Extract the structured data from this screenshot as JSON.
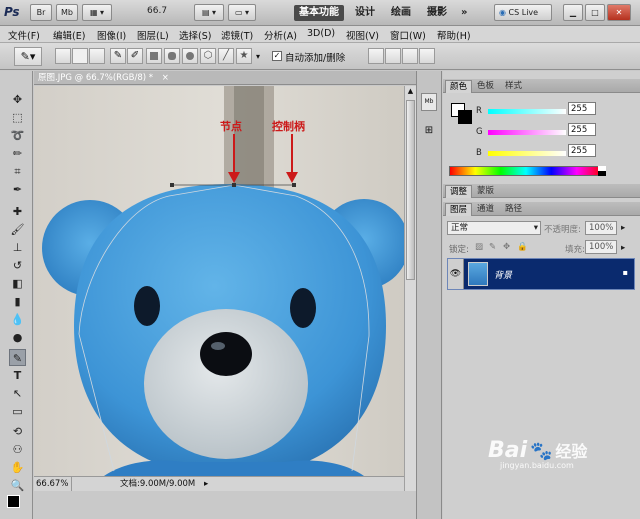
{
  "app": {
    "logo": "Ps",
    "br_label": "Br",
    "mb_label": "Mb",
    "zoom_value": "66.7",
    "workspaces": [
      "基本功能",
      "设计",
      "绘画",
      "摄影"
    ],
    "cs_live_label": "CS Live",
    "overflow_symbol": "»"
  },
  "menus": [
    "文件(F)",
    "编辑(E)",
    "图像(I)",
    "图层(L)",
    "选择(S)",
    "滤镜(T)",
    "分析(A)",
    "3D(D)",
    "视图(V)",
    "窗口(W)",
    "帮助(H)"
  ],
  "options": {
    "auto_add_delete_label": "自动添加/删除",
    "auto_add_delete_checked": true
  },
  "document": {
    "tab_title": "原图.JPG @ 66.7%(RGB/8) *",
    "zoom_status": "66.67%",
    "doc_info": "文档:9.00M/9.00M"
  },
  "annotations": {
    "anchor_label": "节点",
    "handle_label": "控制柄",
    "color": "#cc1a1a"
  },
  "color_panel": {
    "tabs": [
      "颜色",
      "色板",
      "样式"
    ],
    "channels": [
      {
        "label": "R",
        "value": "255"
      },
      {
        "label": "G",
        "value": "255"
      },
      {
        "label": "B",
        "value": "255"
      }
    ]
  },
  "adjust_panel": {
    "tabs": [
      "调整",
      "蒙版"
    ]
  },
  "layers_panel": {
    "tabs": [
      "图层",
      "通道",
      "路径"
    ],
    "blend_mode": "正常",
    "opacity_label": "不透明度:",
    "opacity_value": "100%",
    "lock_label": "锁定:",
    "fill_label": "填充:",
    "fill_value": "100%",
    "layers": [
      {
        "name": "背景",
        "selected": true
      }
    ]
  },
  "watermark": {
    "brand": "Bai",
    "brand2": "经验",
    "url": "jingyan.baidu.com"
  }
}
